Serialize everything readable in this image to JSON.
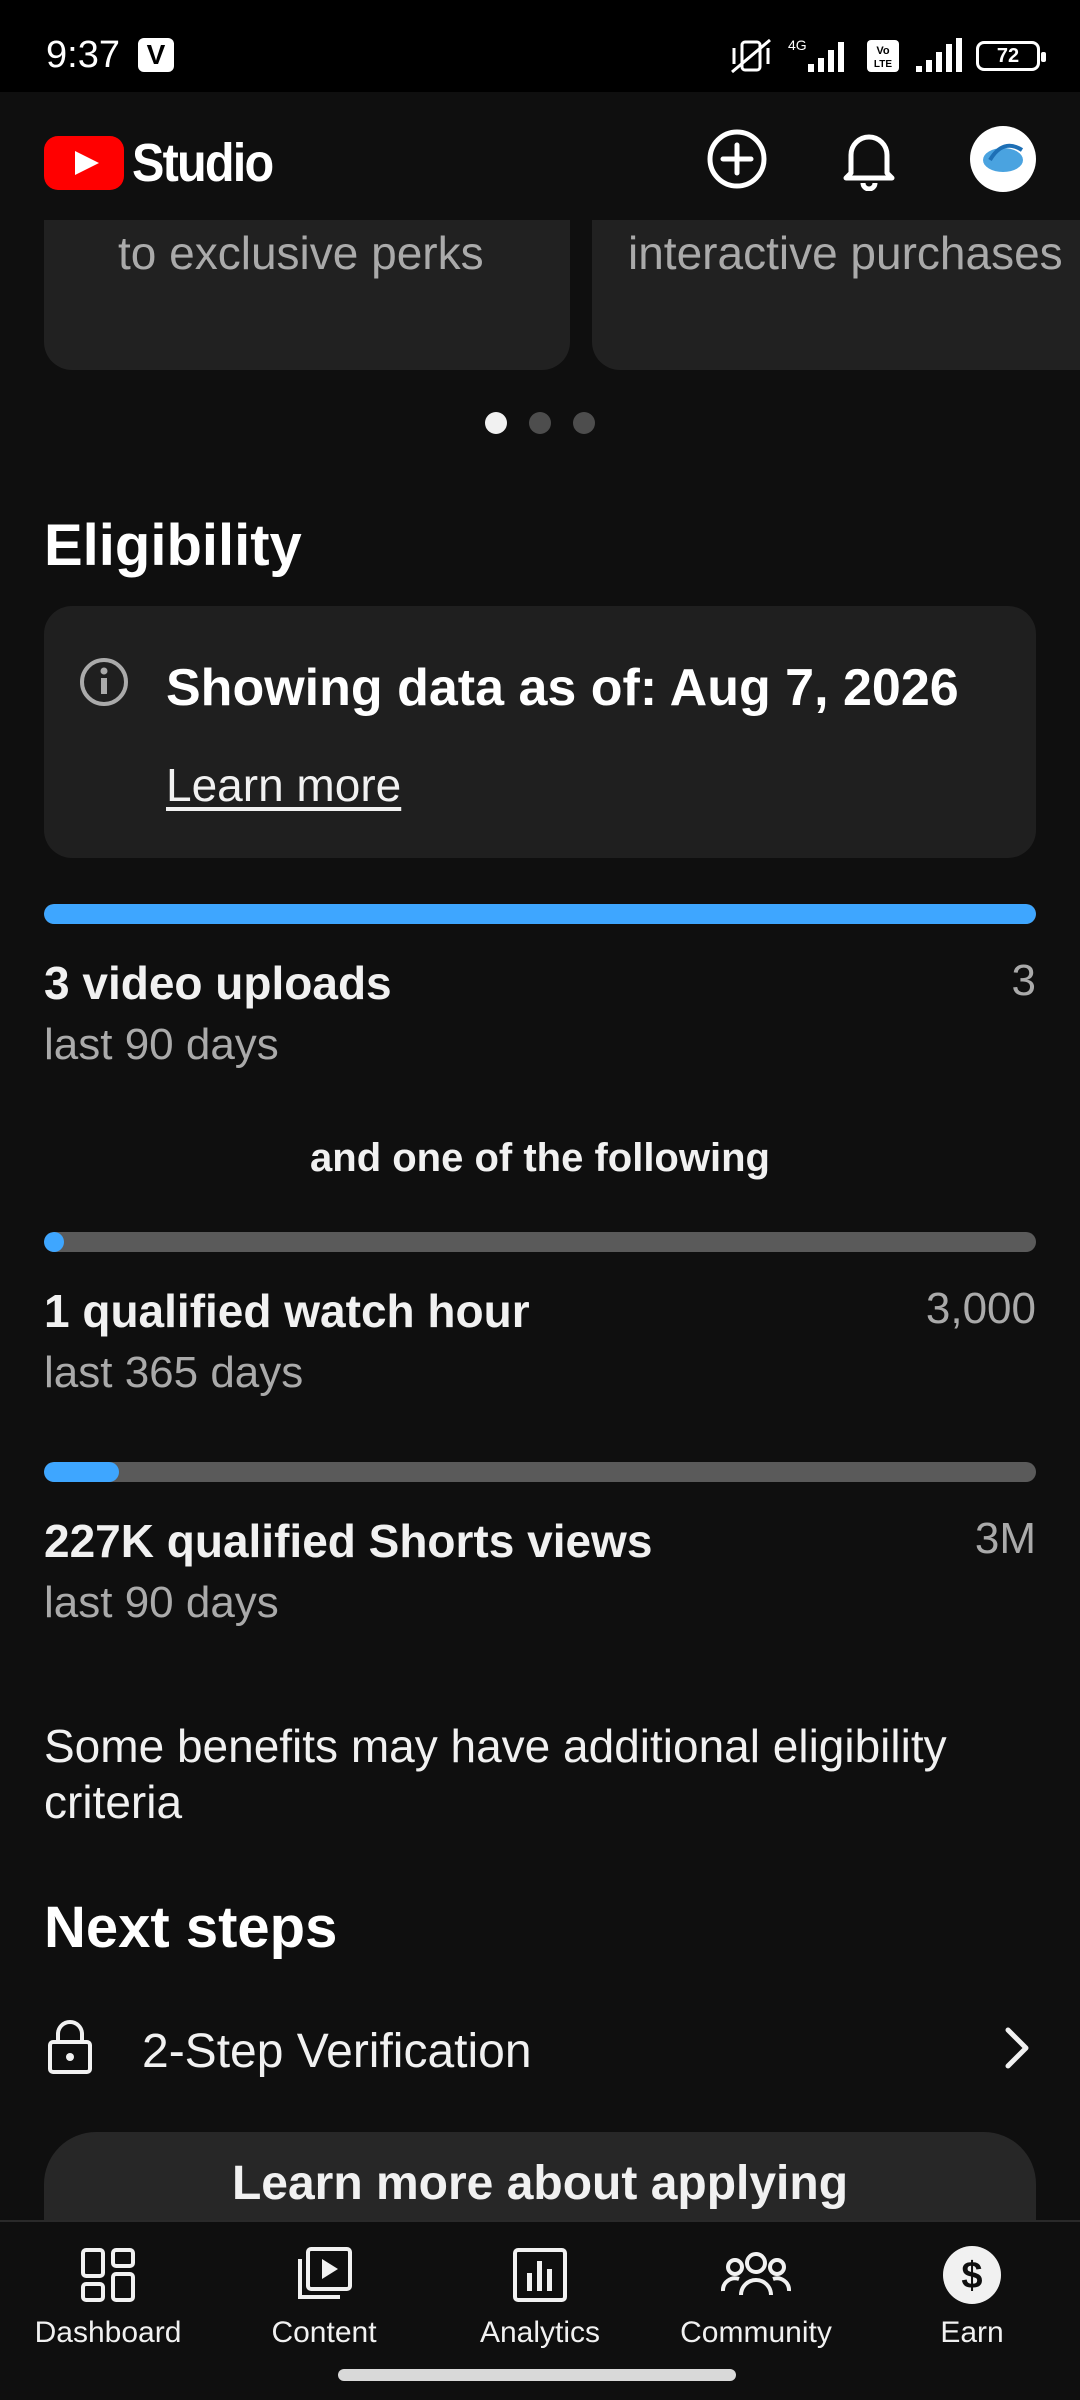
{
  "status_bar": {
    "time": "9:37",
    "app_badge": "V",
    "network_label": "4G",
    "volte_label": "Vo LTE",
    "battery": "72"
  },
  "app_bar": {
    "title": "Studio",
    "icons": [
      "add-circle-icon",
      "bell-icon",
      "avatar"
    ]
  },
  "carousel": {
    "cards": [
      {
        "text": "to exclusive perks"
      },
      {
        "text": "interactive purchases"
      }
    ],
    "page_count": 3,
    "active_index": 0
  },
  "eligibility": {
    "heading": "Eligibility",
    "info_title": "Showing data as of: Aug 7, 2026",
    "info_link": "Learn more",
    "requirements": [
      {
        "title": "3 video uploads",
        "subtitle": "last 90 days",
        "target": "3",
        "progress": 1.0
      },
      {
        "title": "1 qualified watch hour",
        "subtitle": "last 365 days",
        "target": "3,000",
        "progress": 0.0003
      },
      {
        "title": "227K qualified Shorts views",
        "subtitle": "last 90 days",
        "target": "3M",
        "progress": 0.076
      }
    ],
    "separator": "and one of the following",
    "note": "Some benefits may have additional eligibility criteria"
  },
  "next_steps": {
    "heading": "Next steps",
    "items": [
      {
        "label": "2-Step Verification",
        "icon": "lock-icon"
      }
    ],
    "apply_button": "Learn more about applying"
  },
  "bottom_nav": {
    "items": [
      {
        "label": "Dashboard",
        "icon": "dashboard-icon"
      },
      {
        "label": "Content",
        "icon": "content-icon"
      },
      {
        "label": "Analytics",
        "icon": "analytics-icon"
      },
      {
        "label": "Community",
        "icon": "community-icon"
      },
      {
        "label": "Earn",
        "icon": "earn-icon",
        "active": true
      }
    ]
  },
  "colors": {
    "background": "#0f0f0f",
    "accent": "#3ea6ff",
    "brand_red": "#ff0000",
    "card": "#1f1f1f"
  }
}
